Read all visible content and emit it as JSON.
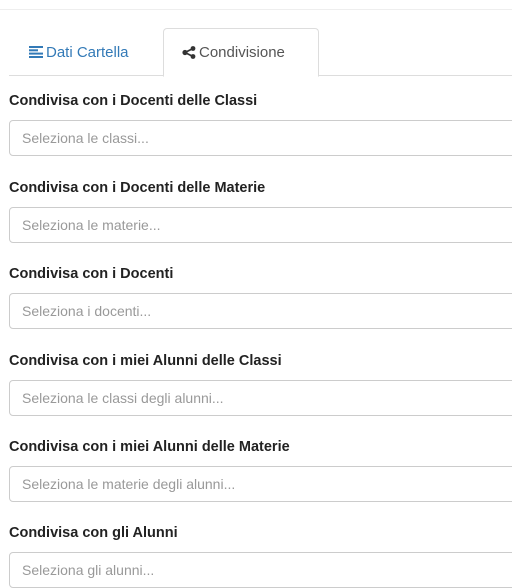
{
  "tabs": [
    {
      "label": "Dati Cartella",
      "icon": "align-left-icon",
      "active": false
    },
    {
      "label": "Condivisione",
      "icon": "share-icon",
      "active": true
    }
  ],
  "fields": [
    {
      "label": "Condivisa con i Docenti delle Classi",
      "placeholder": "Seleziona le classi..."
    },
    {
      "label": "Condivisa con i Docenti delle Materie",
      "placeholder": "Seleziona le materie..."
    },
    {
      "label": "Condivisa con i Docenti",
      "placeholder": "Seleziona i docenti..."
    },
    {
      "label": "Condivisa con i miei Alunni delle Classi",
      "placeholder": "Seleziona le classi degli alunni..."
    },
    {
      "label": "Condivisa con i miei Alunni delle Materie",
      "placeholder": "Seleziona le materie degli alunni..."
    },
    {
      "label": "Condivisa con gli Alunni",
      "placeholder": "Seleziona gli alunni..."
    }
  ],
  "colors": {
    "link": "#337ab7",
    "placeholder": "#999999",
    "border": "#cccccc"
  }
}
